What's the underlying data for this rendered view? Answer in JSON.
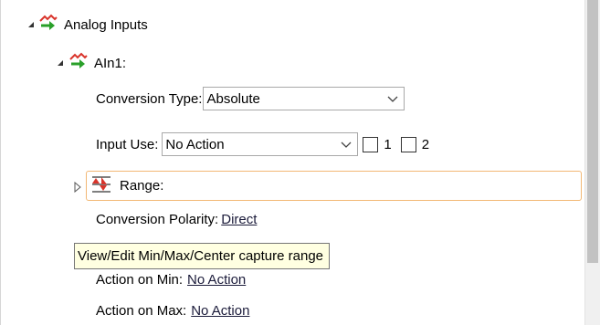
{
  "tree": {
    "root": {
      "label": "Analog Inputs",
      "icon": "analog-input-arrows-icon"
    },
    "child": {
      "label": "AIn1:",
      "icon": "analog-input-arrows-icon"
    }
  },
  "properties": {
    "conversion_type": {
      "label": "Conversion Type:",
      "value": "Absolute"
    },
    "input_use": {
      "label": "Input Use:",
      "value": "No Action",
      "check1_label": "1",
      "check2_label": "2"
    },
    "range": {
      "label": "Range:",
      "icon": "range-arrows-icon"
    },
    "conversion_polarity": {
      "label": "Conversion Polarity:",
      "value": "Direct"
    },
    "action_on_min": {
      "label": "Action on Min:",
      "value": "No Action"
    },
    "action_on_max": {
      "label": "Action on Max:",
      "value": "No Action"
    }
  },
  "tooltip": {
    "text": "View/Edit Min/Max/Center capture range"
  },
  "colors": {
    "icon_red": "#d9342b",
    "icon_green": "#2aa02a",
    "selection_border": "#f2b875",
    "tooltip_bg": "#ffffe1"
  }
}
